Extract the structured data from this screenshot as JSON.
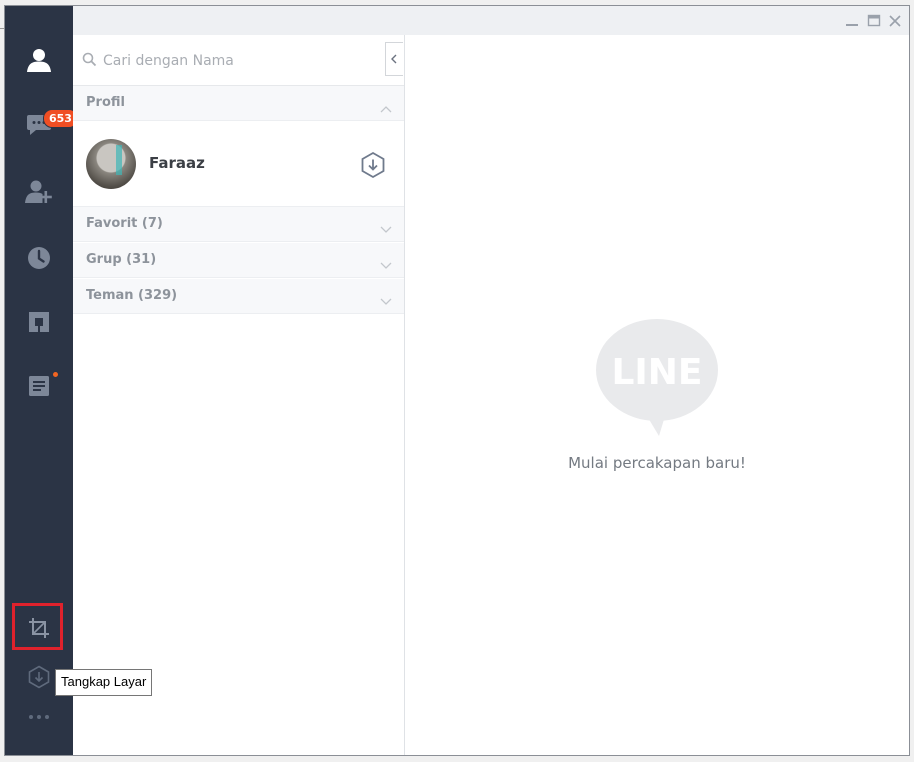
{
  "nav": {
    "items": [
      {
        "id": "friends",
        "icon": "person-icon"
      },
      {
        "id": "chats",
        "icon": "chat-bubble-icon",
        "badge": "653"
      },
      {
        "id": "add-friend",
        "icon": "add-person-icon"
      },
      {
        "id": "timeline",
        "icon": "clock-icon"
      },
      {
        "id": "apps",
        "icon": "square-icon"
      },
      {
        "id": "notes",
        "icon": "note-icon"
      }
    ],
    "bottom": [
      {
        "id": "screen-capture",
        "icon": "crop-icon",
        "tooltip": "Tangkap Layar"
      },
      {
        "id": "update",
        "icon": "download-hex-icon"
      },
      {
        "id": "more",
        "icon": "ellipsis-icon"
      }
    ]
  },
  "search": {
    "placeholder": "Cari dengan Nama"
  },
  "sections": {
    "profile": "Profil",
    "favorites": "Favorit (7)",
    "groups": "Grup (31)",
    "friends": "Teman (329)"
  },
  "profile": {
    "name": "Faraaz"
  },
  "chat": {
    "empty_message": "Mulai percakapan baru!",
    "logo_text": "LINE"
  },
  "colors": {
    "sidebar": "#2b3445",
    "badge": "#f04e23",
    "highlight": "#e0222c"
  }
}
